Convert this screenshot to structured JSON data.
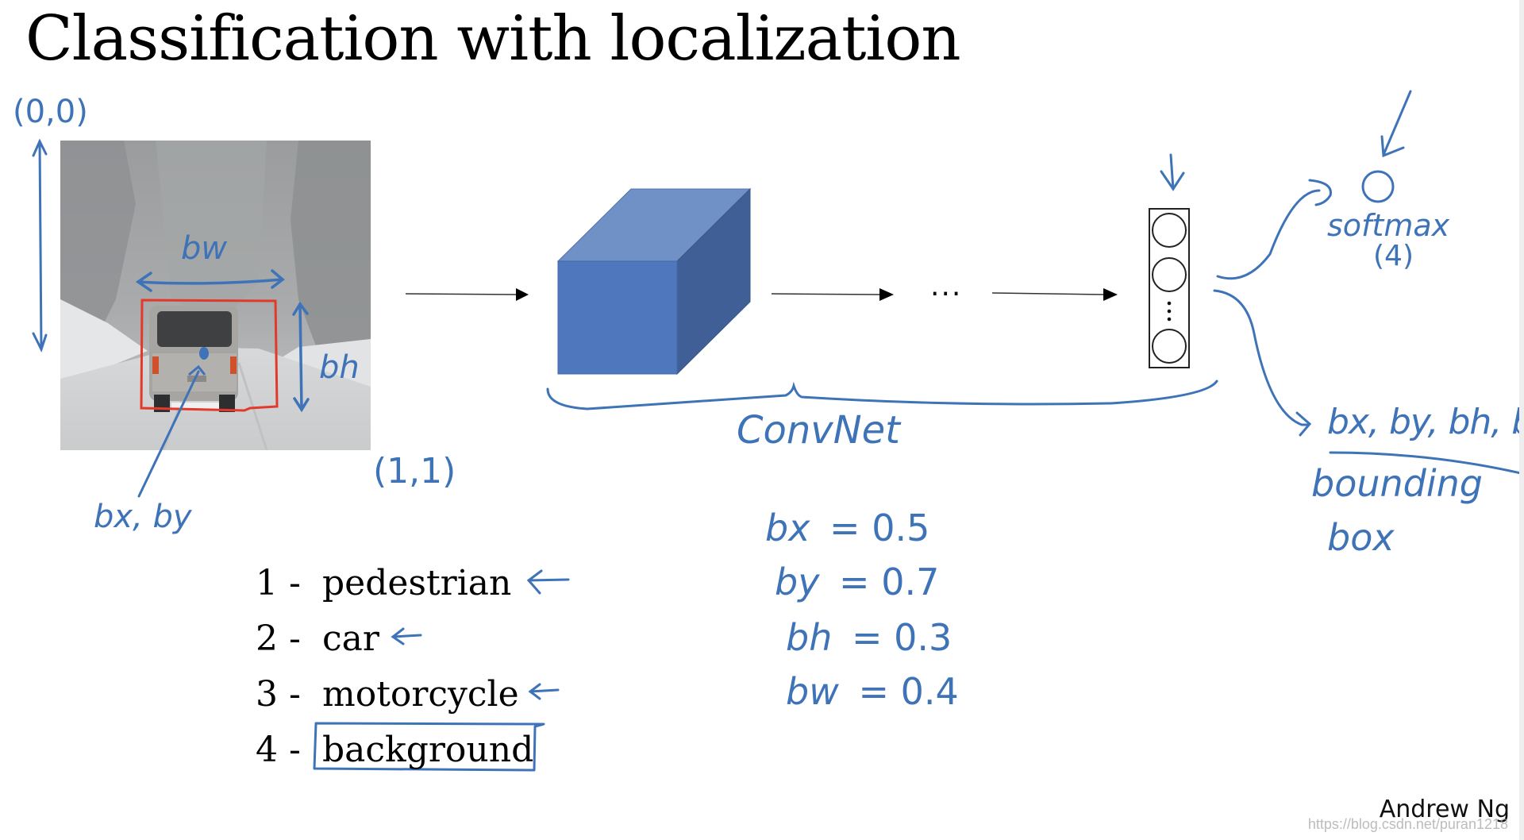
{
  "slide": {
    "title": "Classification with localization",
    "author": "Andrew Ng",
    "watermark": "https://blog.csdn.net/puran1218"
  },
  "colors": {
    "ink_blue": "#3f73b8",
    "bbox_red": "#e2392b",
    "cube_front": "#4f77bd",
    "cube_top": "#7091c6",
    "cube_side": "#3f5f96"
  },
  "image_annotations": {
    "origin_label": "(0,0)",
    "corner_label": "(1,1)",
    "width_label": "bw",
    "height_label": "bh",
    "center_label": "bx, by"
  },
  "network": {
    "ellipsis": "...",
    "label": "ConvNet",
    "layer_ellipsis": "⋮"
  },
  "outputs": {
    "softmax_label": "softmax",
    "softmax_count": "(4)",
    "bbox_params": "bx, by, bh, bw",
    "bbox_label_line1": "bounding",
    "bbox_label_line2": "box"
  },
  "classes": [
    {
      "num": "1 -",
      "name": "pedestrian",
      "arrow": true,
      "boxed": false
    },
    {
      "num": "2 -",
      "name": "car",
      "arrow": true,
      "boxed": false
    },
    {
      "num": "3 -",
      "name": "motorcycle",
      "arrow": true,
      "boxed": false
    },
    {
      "num": "4 -",
      "name": "background",
      "arrow": false,
      "boxed": true
    }
  ],
  "bbox_values": [
    {
      "label": "bx",
      "eq": "= 0.5",
      "value": 0.5
    },
    {
      "label": "by",
      "eq": "= 0.7",
      "value": 0.7
    },
    {
      "label": "bh",
      "eq": "= 0.3",
      "value": 0.3
    },
    {
      "label": "bw",
      "eq": "= 0.4",
      "value": 0.4
    }
  ]
}
